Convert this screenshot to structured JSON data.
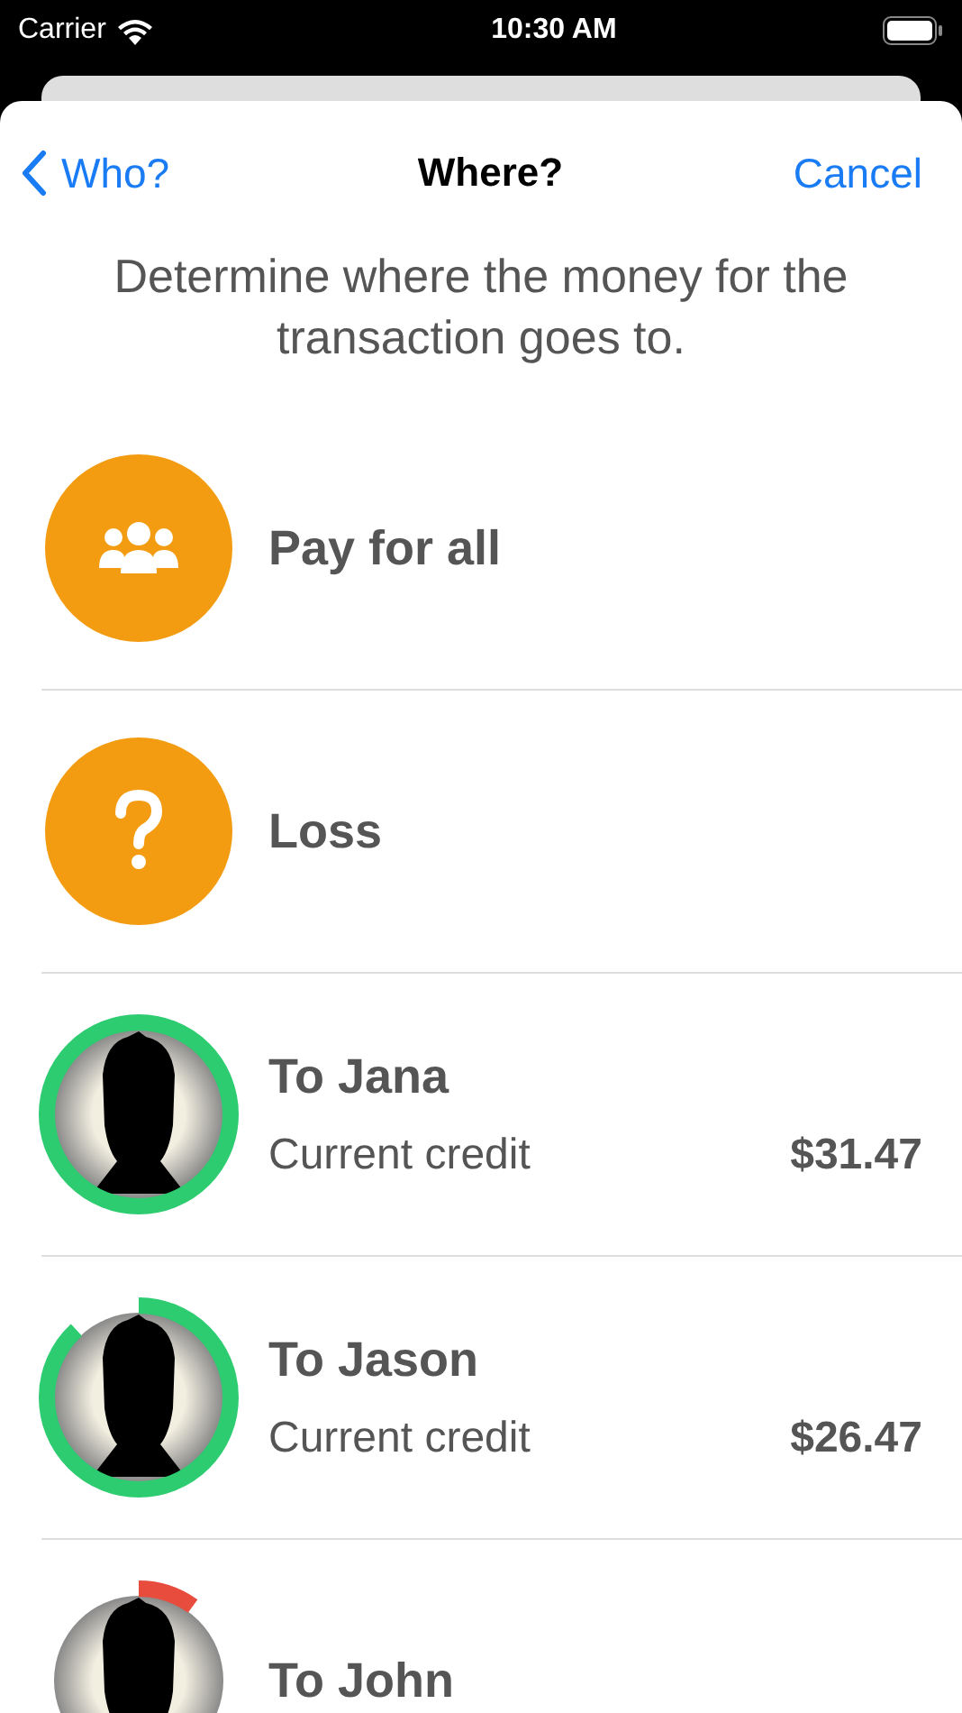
{
  "status_bar": {
    "carrier": "Carrier",
    "time": "10:30 AM"
  },
  "nav": {
    "back": "Who?",
    "title": "Where?",
    "action": "Cancel"
  },
  "description": "Determine where the money for the transaction goes to.",
  "rows": [
    {
      "kind": "group",
      "title": "Pay for all"
    },
    {
      "kind": "unknown",
      "title": "Loss"
    },
    {
      "kind": "person",
      "title": "To Jana",
      "subtitle": "Current credit",
      "amount": "$31.47",
      "level": 1,
      "color": "#2ecc71"
    },
    {
      "kind": "person",
      "title": "To Jason",
      "subtitle": "Current credit",
      "amount": "$26.47",
      "level": 0.88,
      "color": "#2ecc71"
    },
    {
      "kind": "person",
      "title": "To John",
      "level": 0.1,
      "color": "#e74c3c"
    }
  ]
}
